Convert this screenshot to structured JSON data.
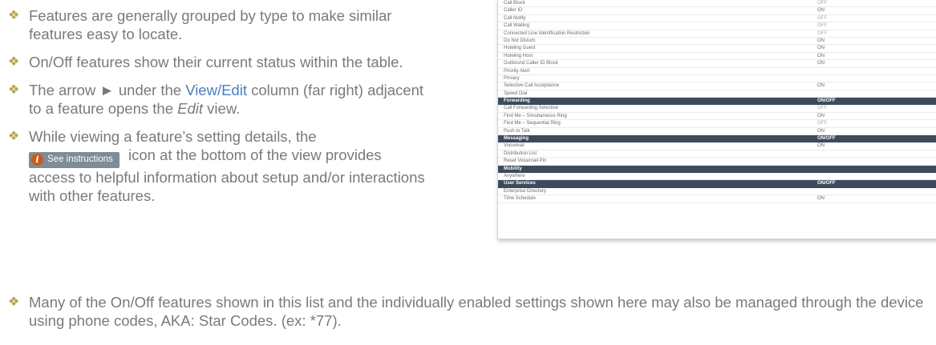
{
  "bullets": [
    "Features are generally grouped by type to make similar features easy to locate.",
    "On/Off features show their current status within the table.",
    {
      "pre": "The arrow ► under the ",
      "link": "View/Edit",
      "mid": " column (far right) adjacent to a feature opens the ",
      "emph": "Edit",
      "post": " view."
    },
    {
      "pre": "While viewing a feature’s setting details, the",
      "button_label": "See instructions",
      "post": " icon at the bottom of the view provides access to helpful information about setup and/or interactions with other features."
    }
  ],
  "bottom_bullet": "Many of the On/Off features shown in this list and the individually enabled settings shown here may also be managed through the device using phone codes, AKA: Star Codes. (ex: *77).",
  "table": {
    "rows": [
      {
        "name": "Call Block",
        "status": "OFF",
        "section": false
      },
      {
        "name": "Caller ID",
        "status": "ON",
        "section": false
      },
      {
        "name": "Call Notify",
        "status": "OFF",
        "section": false
      },
      {
        "name": "Call Waiting",
        "status": "OFF",
        "section": false
      },
      {
        "name": "Connected Line Identification Restriction",
        "status": "OFF",
        "section": false
      },
      {
        "name": "Do Not Disturb",
        "status": "ON",
        "section": false
      },
      {
        "name": "Hoteling Guest",
        "status": "ON",
        "section": false
      },
      {
        "name": "Hoteling Host",
        "status": "ON",
        "section": false
      },
      {
        "name": "Outbound Caller ID Block",
        "status": "ON",
        "section": false
      },
      {
        "name": "Priority Alert",
        "status": "",
        "section": false
      },
      {
        "name": "Privacy",
        "status": "",
        "section": false
      },
      {
        "name": "Selective Call Acceptance",
        "status": "ON",
        "section": false
      },
      {
        "name": "Speed Dial",
        "status": "",
        "section": false
      },
      {
        "name": "Forwarding",
        "status": "ON/OFF",
        "section": true
      },
      {
        "name": "Call Forwarding Selective",
        "status": "OFF",
        "section": false
      },
      {
        "name": "Find Me – Simultaneous Ring",
        "status": "ON",
        "section": false
      },
      {
        "name": "Find Me – Sequential Ring",
        "status": "OFF",
        "section": false
      },
      {
        "name": "Push to Talk",
        "status": "ON",
        "section": false
      },
      {
        "name": "Messaging",
        "status": "ON/OFF",
        "section": true
      },
      {
        "name": "Voicemail",
        "status": "ON",
        "section": false
      },
      {
        "name": "Distribution List",
        "status": "",
        "section": false
      },
      {
        "name": "Reset Voicemail Pin",
        "status": "",
        "section": false
      },
      {
        "name": "Mobility",
        "status": "",
        "section": true
      },
      {
        "name": "Anywhere",
        "status": "",
        "section": false
      },
      {
        "name": "User Services",
        "status": "ON/OFF",
        "section": true
      },
      {
        "name": "Enterprise Directory",
        "status": "",
        "section": false
      },
      {
        "name": "Time Schedule",
        "status": "ON",
        "section": false
      }
    ]
  },
  "colors": {
    "bullet_text": "#7a7a7a",
    "bullet_diamond": "#b8a14a",
    "link_blue": "#4a7fc1",
    "section_header_bg": "#3d4a5c"
  },
  "icons": {
    "bullet": "diamond-bullet-icon",
    "info": "info-icon"
  }
}
